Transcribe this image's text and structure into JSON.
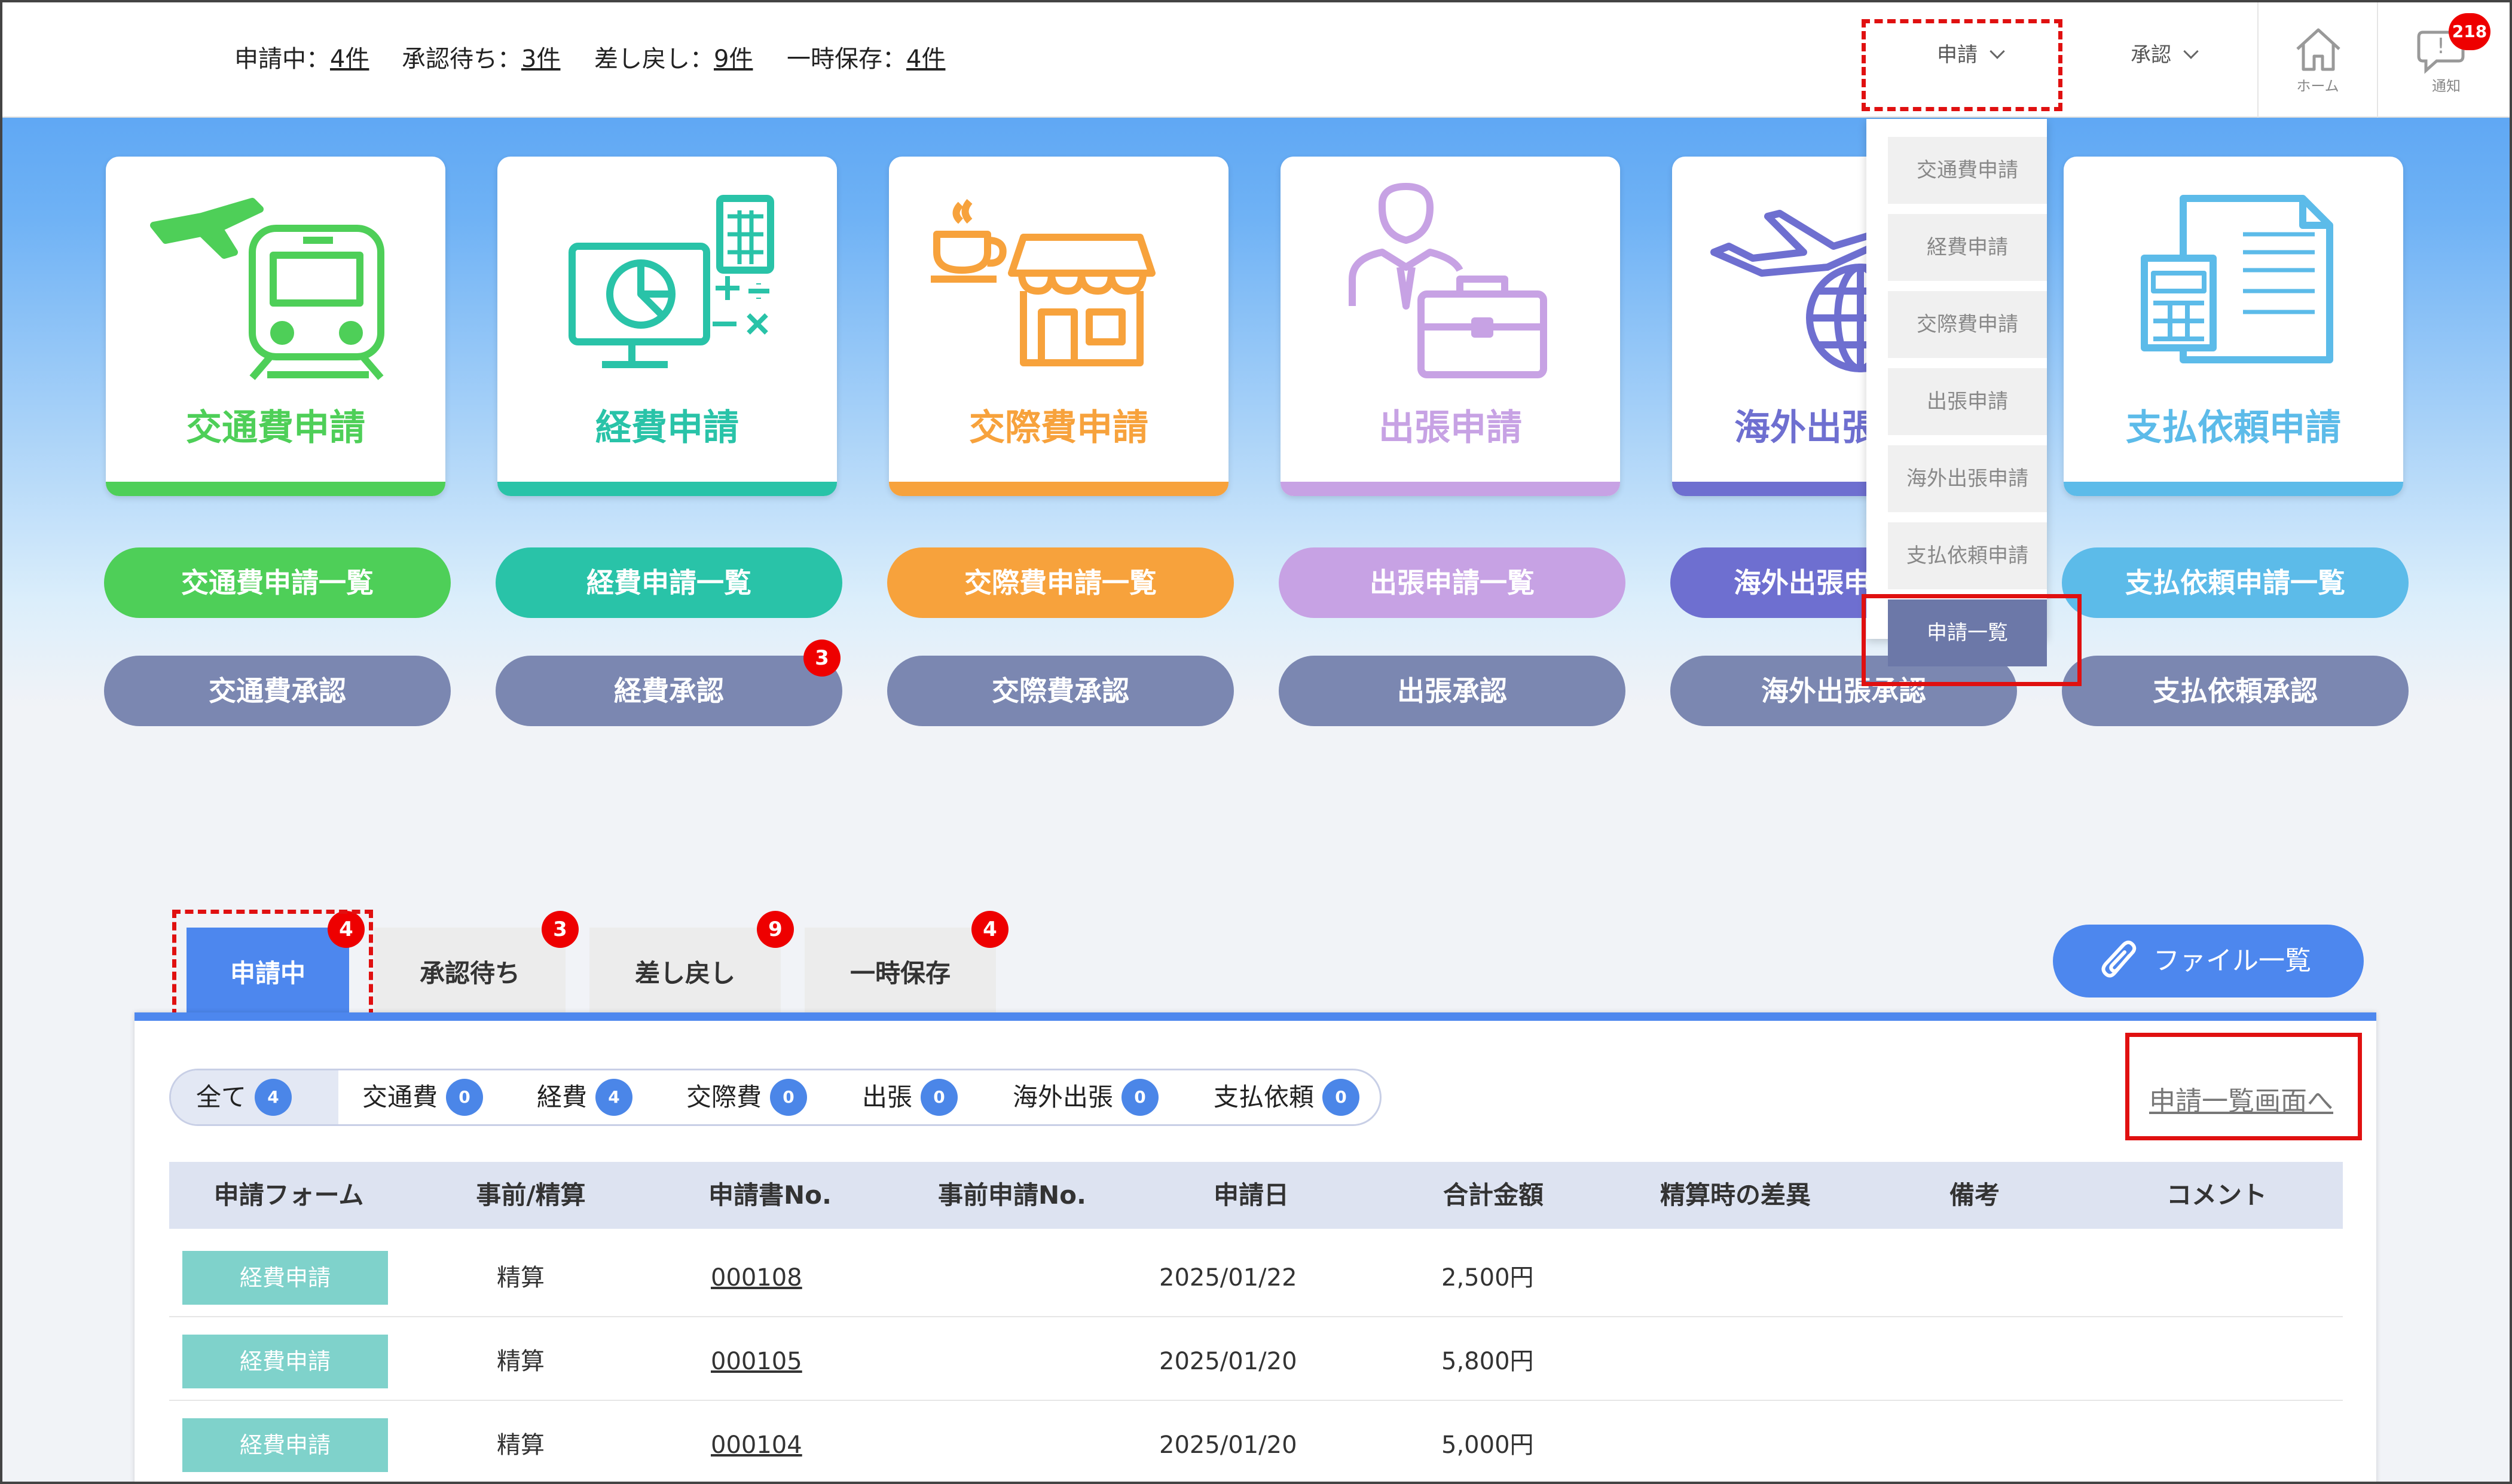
{
  "header": {
    "stats": [
      {
        "label": "申請中：",
        "value": "4件"
      },
      {
        "label": "承認待ち：",
        "value": "3件"
      },
      {
        "label": "差し戻し：",
        "value": "9件"
      },
      {
        "label": "一時保存：",
        "value": "4件"
      }
    ],
    "nav_apply": "申請",
    "nav_approve": "承認",
    "home_label": "ホーム",
    "notify_label": "通知",
    "notify_count": "218"
  },
  "dropdown": {
    "items": [
      "交通費申請",
      "経費申請",
      "交際費申請",
      "出張申請",
      "海外出張申請",
      "支払依頼申請"
    ],
    "list_item": "申請一覧"
  },
  "cards": [
    {
      "title": "交通費申請",
      "color": "#4ecf58",
      "list": "交通費申請一覧",
      "approve": "交通費承認"
    },
    {
      "title": "経費申請",
      "color": "#29c3a8",
      "list": "経費申請一覧",
      "approve": "経費承認",
      "badge": "3"
    },
    {
      "title": "交際費申請",
      "color": "#f7a23c",
      "list": "交際費申請一覧",
      "approve": "交際費承認"
    },
    {
      "title": "出張申請",
      "color": "#c7a2e4",
      "list": "出張申請一覧",
      "approve": "出張承認"
    },
    {
      "title": "海外出張申請",
      "color": "#6e6fd0",
      "list": "海外出張申請一覧",
      "approve": "海外出張承認"
    },
    {
      "title": "支払依頼申請",
      "color": "#5cbbe9",
      "list": "支払依頼申請一覧",
      "approve": "支払依頼承認"
    }
  ],
  "approve_color": "#7b87b1",
  "tabs": [
    {
      "label": "申請中",
      "badge": "4"
    },
    {
      "label": "承認待ち",
      "badge": "3"
    },
    {
      "label": "差し戻し",
      "badge": "9"
    },
    {
      "label": "一時保存",
      "badge": "4"
    }
  ],
  "file_list_button": "ファイル一覧",
  "list_screen_link": "申請一覧画面へ",
  "filters": [
    {
      "label": "全て",
      "count": "4"
    },
    {
      "label": "交通費",
      "count": "0"
    },
    {
      "label": "経費",
      "count": "4"
    },
    {
      "label": "交際費",
      "count": "0"
    },
    {
      "label": "出張",
      "count": "0"
    },
    {
      "label": "海外出張",
      "count": "0"
    },
    {
      "label": "支払依頼",
      "count": "0"
    }
  ],
  "table": {
    "columns": [
      "申請フォーム",
      "事前/精算",
      "申請書No.",
      "事前申請No.",
      "申請日",
      "合計金額",
      "精算時の差異",
      "備考",
      "コメント"
    ],
    "rows": [
      {
        "form": "経費申請",
        "type": "精算",
        "no": "000108",
        "date": "2025/01/22",
        "amount": "2,500円"
      },
      {
        "form": "経費申請",
        "type": "精算",
        "no": "000105",
        "date": "2025/01/20",
        "amount": "5,800円"
      },
      {
        "form": "経費申請",
        "type": "精算",
        "no": "000104",
        "date": "2025/01/20",
        "amount": "5,000円"
      }
    ]
  }
}
